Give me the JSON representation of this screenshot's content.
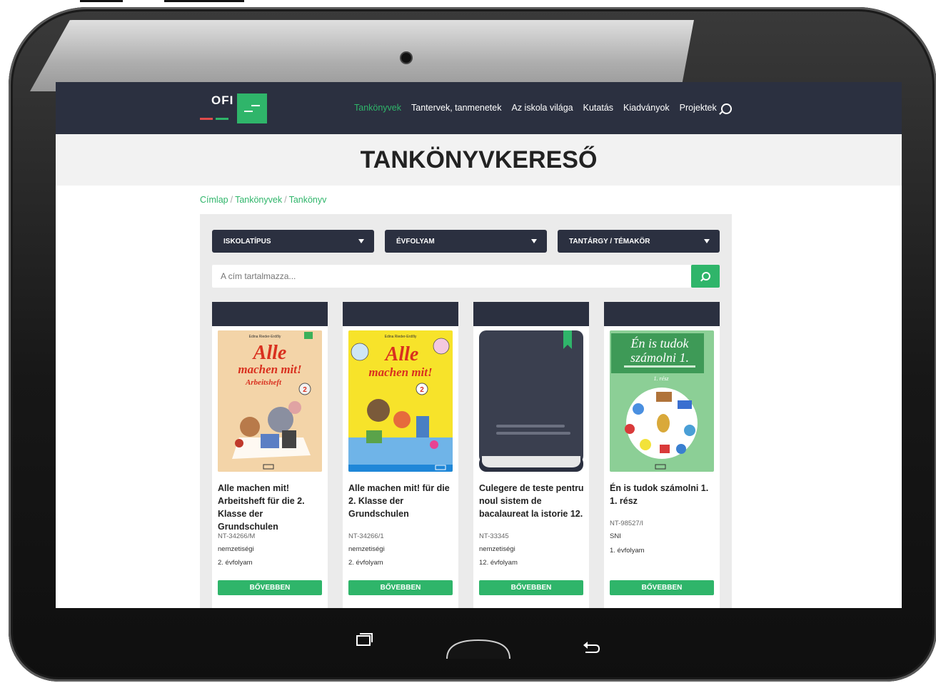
{
  "nav": {
    "logo": "OFI",
    "items": [
      "Tankönyvek",
      "Tantervek, tanmenetek",
      "Az iskola világa",
      "Kutatás",
      "Kiadványok",
      "Projektek"
    ]
  },
  "page": {
    "title": "TANKÖNYVKERESŐ"
  },
  "breadcrumb": [
    "Címlap",
    "Tankönyvek",
    "Tankönyv"
  ],
  "filters": {
    "school_type": "ISKOLATÍPUS",
    "grade": "ÉVFOLYAM",
    "subject": "TANTÁRGY / TÉMAKÖR"
  },
  "search": {
    "placeholder": "A cím tartalmazza..."
  },
  "books": [
    {
      "title": "Alle machen mit! Arbeitsheft für die 2. Klasse der Grundschulen",
      "code": "NT-34266/M",
      "type": "nemzetiségi",
      "grade": "2. évfolyam",
      "button": "BŐVEBBEN",
      "cover": {
        "author": "Edina Rieder-Erdőly",
        "line1": "Alle",
        "line2": "machen mit!",
        "line3": "Arbeitsheft",
        "num": "2"
      }
    },
    {
      "title": "Alle machen mit! für die 2. Klasse der Grundschulen",
      "code": "NT-34266/1",
      "type": "nemzetiségi",
      "grade": "2. évfolyam",
      "button": "BŐVEBBEN",
      "cover": {
        "author": "Edina Rieder-Erdőly",
        "line1": "Alle",
        "line2": "machen mit!",
        "num": "2"
      }
    },
    {
      "title": "Culegere de teste pentru noul sistem de bacalaureat la istorie 12.",
      "code": "NT-33345",
      "type": "nemzetiségi",
      "grade": "12. évfolyam",
      "button": "BŐVEBBEN"
    },
    {
      "title": "Én is tudok számolni 1. 1. rész",
      "code": "NT-98527/I",
      "type": "SNI",
      "grade": "1. évfolyam",
      "button": "BŐVEBBEN",
      "cover": {
        "line1": "Én is tudok",
        "line2": "számolni 1.",
        "sub": "1. rész"
      }
    }
  ],
  "colors": {
    "navy": "#2b3040",
    "green": "#2fb56a",
    "red": "#e04b4b"
  }
}
